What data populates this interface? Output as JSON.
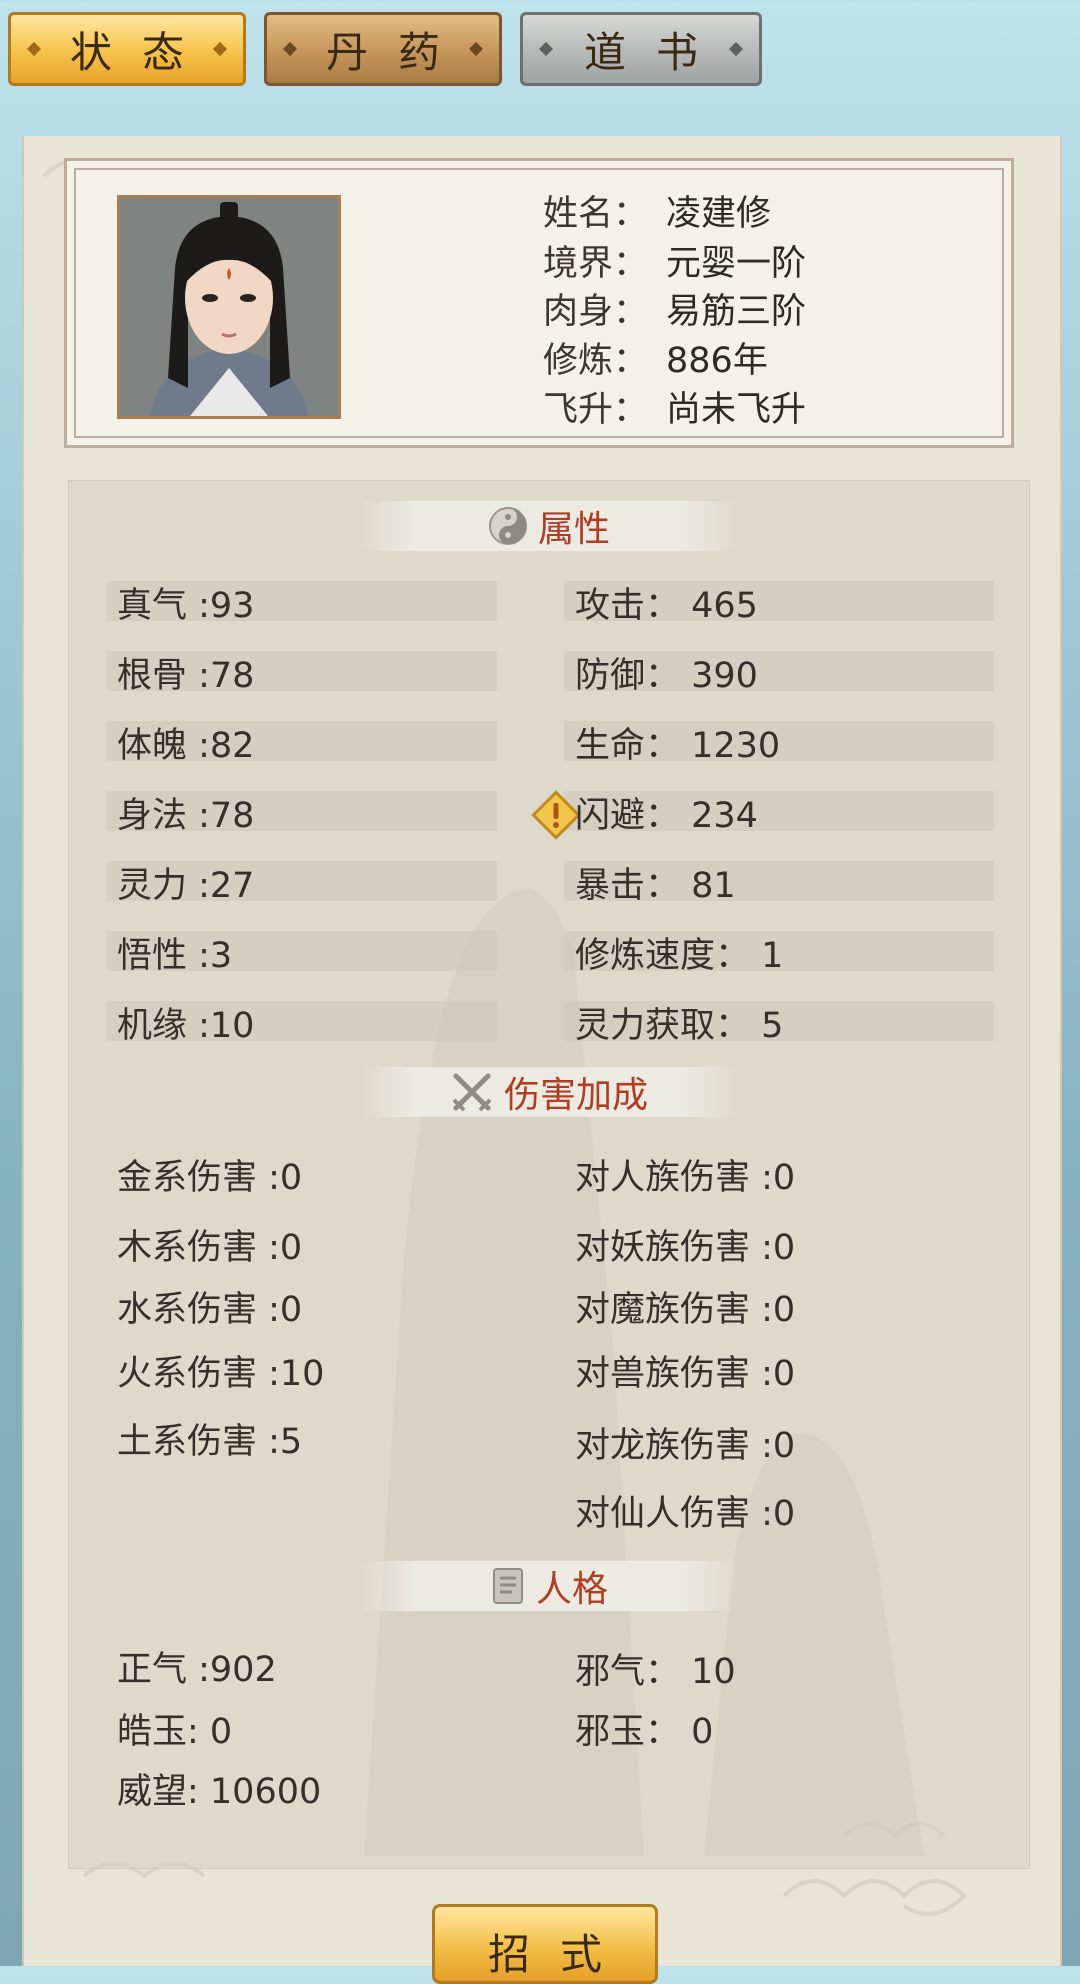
{
  "tabs": [
    {
      "label": "状态",
      "active": true
    },
    {
      "label": "丹药",
      "active": false
    },
    {
      "label": "道书",
      "active": false
    }
  ],
  "profile": {
    "fields": [
      {
        "key": "姓名：",
        "value": "凌建修"
      },
      {
        "key": "境界：",
        "value": "元婴一阶"
      },
      {
        "key": "肉身：",
        "value": "易筋三阶"
      },
      {
        "key": "修炼：",
        "value": "886年"
      },
      {
        "key": "飞升：",
        "value": "尚未飞升"
      }
    ]
  },
  "sections": {
    "attributes": {
      "title": "属性"
    },
    "damage": {
      "title": "伤害加成"
    },
    "personality": {
      "title": "人格"
    }
  },
  "attributes": {
    "left": [
      "真气 :93",
      "根骨 :78",
      "体魄 :82",
      "身法 :78",
      "灵力 :27",
      "悟性 :3",
      "机缘 :10"
    ],
    "right": [
      "攻击： 465",
      "防御： 390",
      "生命： 1230",
      "闪避： 234",
      "暴击： 81",
      "修炼速度： 1",
      "灵力获取： 5"
    ]
  },
  "damage": {
    "left": [
      "金系伤害 :0",
      "木系伤害 :0",
      "水系伤害 :0",
      "火系伤害 :10",
      "土系伤害 :5"
    ],
    "right": [
      "对人族伤害 :0",
      "对妖族伤害 :0",
      "对魔族伤害 :0",
      "对兽族伤害 :0",
      "对龙族伤害 :0",
      "对仙人伤害 :0"
    ]
  },
  "personality": {
    "left": [
      "正气 :902",
      "皓玉: 0",
      "威望: 10600"
    ],
    "right": [
      "邪气：  10",
      "邪玉：  0"
    ]
  },
  "bottom_button": {
    "label": "招式"
  },
  "colors": {
    "accent_red": "#b23d25",
    "active_tab": "#f6c24a",
    "panel_bg": "#e8e4d6"
  }
}
